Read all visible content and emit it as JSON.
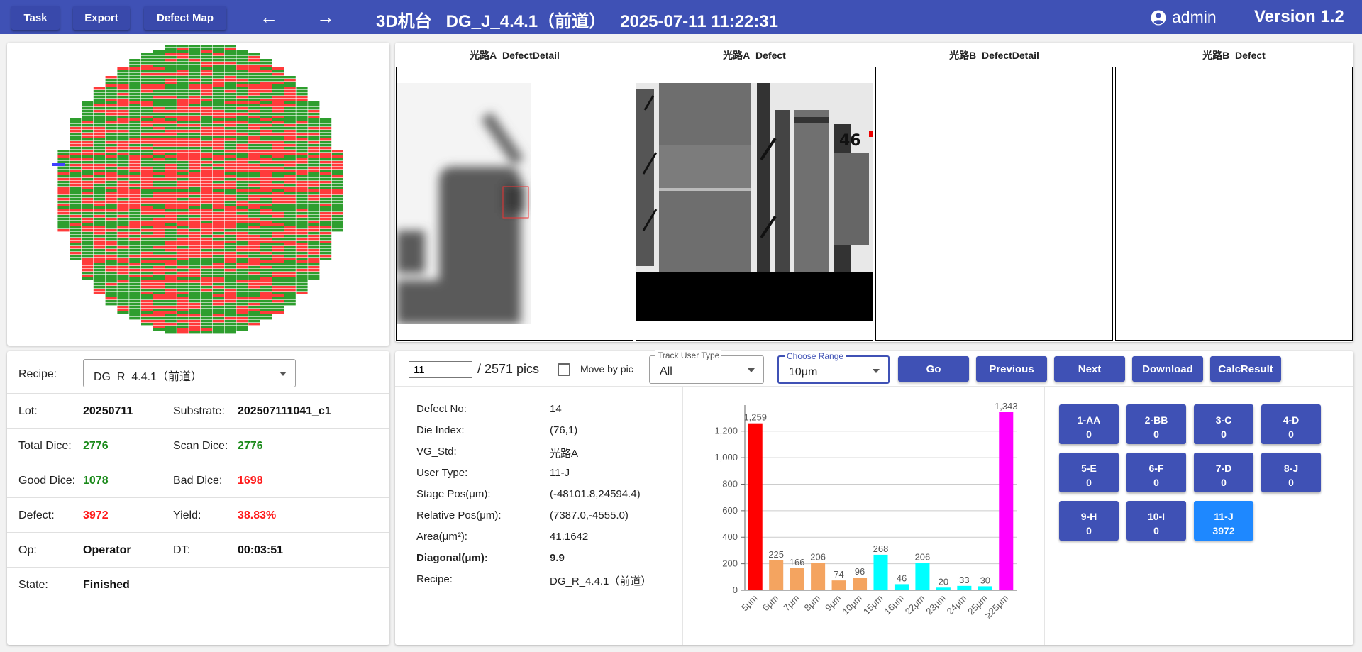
{
  "toolbar": {
    "task_label": "Task",
    "export_label": "Export",
    "defect_map_label": "Defect Map",
    "title": "3D机台   DG_J_4.4.1（前道）   2025-07-11 11:22:31",
    "user": "admin",
    "version": "Version 1.2"
  },
  "images": {
    "titles": [
      "光路A_DefectDetail",
      "光路A_Defect",
      "光路B_DefectDetail",
      "光路B_Defect"
    ]
  },
  "info": {
    "recipe_label": "Recipe:",
    "recipe_value": "DG_R_4.4.1（前道）",
    "lot_label": "Lot:",
    "lot_value": "20250711",
    "substrate_label": "Substrate:",
    "substrate_value": "202507111041_c1",
    "total_dice_label": "Total Dice:",
    "total_dice_value": "2776",
    "scan_dice_label": "Scan Dice:",
    "scan_dice_value": "2776",
    "good_dice_label": "Good Dice:",
    "good_dice_value": "1078",
    "bad_dice_label": "Bad Dice:",
    "bad_dice_value": "1698",
    "defect_label": "Defect:",
    "defect_value": "3972",
    "yield_label": "Yield:",
    "yield_value": "38.83%",
    "op_label": "Op:",
    "op_value": "Operator",
    "dt_label": "DT:",
    "dt_value": "00:03:51",
    "state_label": "State:",
    "state_value": "Finished"
  },
  "controls": {
    "pic_index": "11",
    "pic_total": "/ 2571 pics",
    "move_by_pic_label": "Move by pic",
    "track_user_type_legend": "Track User Type",
    "track_user_type_value": "All",
    "range_legend": "Choose Range",
    "range_value": "10μm",
    "go_label": "Go",
    "previous_label": "Previous",
    "next_label": "Next",
    "download_label": "Download",
    "calc_result_label": "CalcResult"
  },
  "detail": [
    {
      "label": "Defect No:",
      "value": "14"
    },
    {
      "label": "Die Index:",
      "value": "(76,1)"
    },
    {
      "label": "VG_Std:",
      "value": "光路A"
    },
    {
      "label": "User Type:",
      "value": "11-J"
    },
    {
      "label": "Stage Pos(μm):",
      "value": "(-48101.8,24594.4)"
    },
    {
      "label": "Relative Pos(μm):",
      "value": "(7387.0,-4555.0)"
    },
    {
      "label": "Area(μm²):",
      "value": "41.1642"
    },
    {
      "label": "Diagonal(μm):",
      "value": "9.9"
    },
    {
      "label": "Recipe:",
      "value": "DG_R_4.4.1（前道）"
    }
  ],
  "chart_data": {
    "type": "bar",
    "categories": [
      "5μm",
      "6μm",
      "7μm",
      "8μm",
      "9μm",
      "10μm",
      "15μm",
      "16μm",
      "22μm",
      "23μm",
      "24μm",
      "25μm",
      "≥25μm"
    ],
    "values": [
      1259,
      225,
      166,
      206,
      74,
      96,
      268,
      46,
      206,
      20,
      33,
      30,
      1343
    ],
    "value_labels": [
      "1,259",
      "225",
      "166",
      "206",
      "74",
      "96",
      "268",
      "46",
      "206",
      "20",
      "33",
      "30",
      "1,343"
    ],
    "colors": [
      "#ff0000",
      "#f4a460",
      "#f4a460",
      "#f4a460",
      "#f4a460",
      "#f4a460",
      "#00ffff",
      "#00ffff",
      "#00ffff",
      "#00ffff",
      "#00ffff",
      "#00ffff",
      "#ff00ff"
    ],
    "yticks": [
      "0",
      "200",
      "400",
      "600",
      "800",
      "1,000",
      "1,200"
    ],
    "ylim": [
      0,
      1343
    ],
    "grid": true,
    "legend": "none"
  },
  "user_types": [
    {
      "name": "1-AA",
      "count": "0"
    },
    {
      "name": "2-BB",
      "count": "0"
    },
    {
      "name": "3-C",
      "count": "0"
    },
    {
      "name": "4-D",
      "count": "0"
    },
    {
      "name": "5-E",
      "count": "0"
    },
    {
      "name": "6-F",
      "count": "0"
    },
    {
      "name": "7-D",
      "count": "0"
    },
    {
      "name": "8-J",
      "count": "0"
    },
    {
      "name": "9-H",
      "count": "0"
    },
    {
      "name": "10-I",
      "count": "0"
    },
    {
      "name": "11-J",
      "count": "3972"
    }
  ],
  "active_user_type": "11-J",
  "colors": {
    "header": "#3f51b5",
    "button": "#3f51b5",
    "active_button": "#1e88ff",
    "good": "#1a8a1a",
    "bad": "#ff1a1a",
    "wafer_good": "#2e9e2e",
    "wafer_bad": "#ff3b3b"
  }
}
